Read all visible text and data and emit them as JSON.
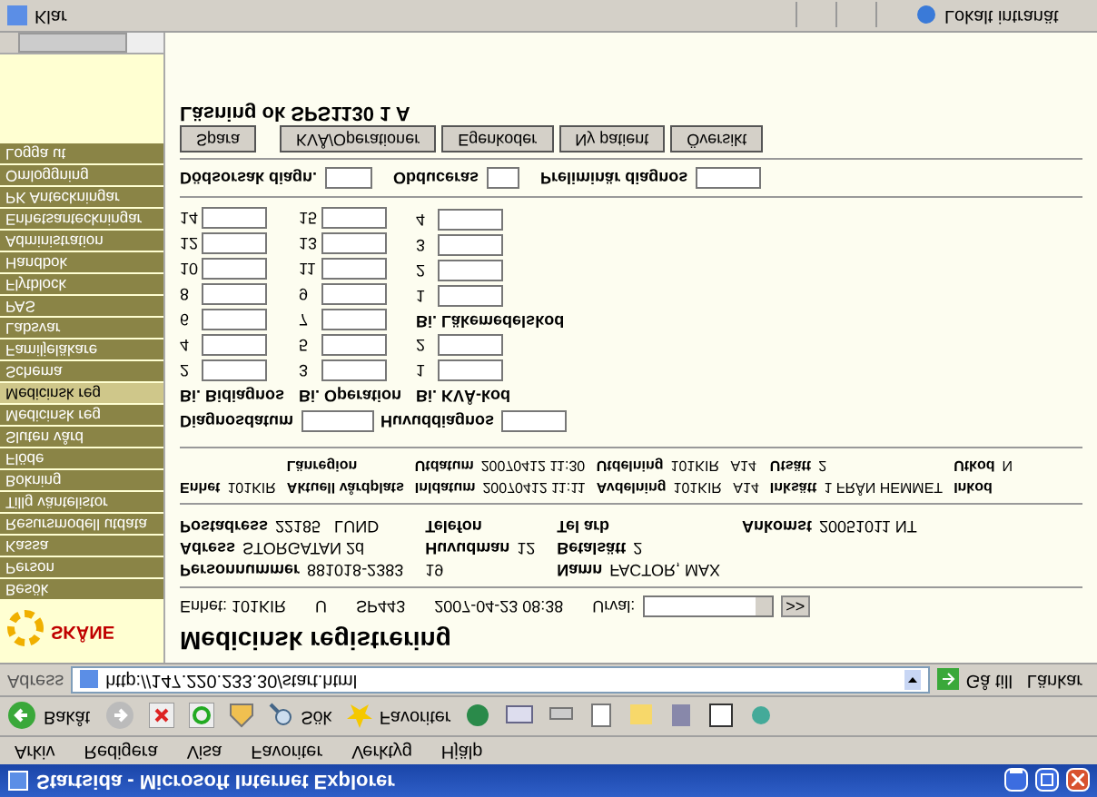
{
  "window": {
    "title": "Startsida - Microsoft Internet Explorer"
  },
  "menu_bar": [
    "Arkiv",
    "Redigera",
    "Visa",
    "Favoriter",
    "Verktyg",
    "Hjälp"
  ],
  "toolbar": {
    "back_label": "Bakåt",
    "search_label": "Sök",
    "favorites_label": "Favoriter"
  },
  "address_bar": {
    "label": "Adress",
    "url": "http://147.220.233.30/start.html",
    "go_label": "Gå till",
    "links_label": "Länkar"
  },
  "sidebar": {
    "logo_text": "SKÅNE",
    "items": [
      {
        "label": "Logga ut",
        "selected": false
      },
      {
        "label": "Omloggning",
        "selected": false
      },
      {
        "label": "PK Anteckningar",
        "selected": false
      },
      {
        "label": "Enhetsanteckningar",
        "selected": false
      },
      {
        "label": "Administration",
        "selected": false
      },
      {
        "label": "Handbok",
        "selected": false
      },
      {
        "label": "Flytblock",
        "selected": false
      },
      {
        "label": "PAS",
        "selected": false
      },
      {
        "label": "Labsvar",
        "selected": false
      },
      {
        "label": "Familjeläkare",
        "selected": false
      },
      {
        "label": "Schema",
        "selected": false
      },
      {
        "label": "Medicinsk reg",
        "selected": true
      },
      {
        "label": "Medicinsk reg",
        "selected": false
      },
      {
        "label": "Sluten vård",
        "selected": false
      },
      {
        "label": "Flöde",
        "selected": false
      },
      {
        "label": "Bokning",
        "selected": false
      },
      {
        "label": "Tillg väntelistor",
        "selected": false
      },
      {
        "label": "Resursmodell utdata",
        "selected": false
      },
      {
        "label": "Kassa",
        "selected": false
      },
      {
        "label": "Person",
        "selected": false
      },
      {
        "label": "Besök",
        "selected": false
      }
    ]
  },
  "page": {
    "title": "Medicinsk registrering",
    "context": {
      "unit": "Enhet: 101KIR",
      "fields": [
        "U",
        "SP443",
        "2007-04-23 08:38"
      ],
      "selection_label": "Urval:",
      "next_button": ">>"
    },
    "patient": [
      [
        {
          "label": "Postadress",
          "value": "22185   LUND"
        },
        {
          "label": "Telefon"
        },
        {
          "label": "Tel arb"
        },
        {
          "label": "Ankomst",
          "value": "20051011 NT"
        }
      ],
      [
        {
          "label": "Adress",
          "value": "STORGATAN 2d"
        },
        {
          "label": "Huvudman",
          "value": "12"
        },
        {
          "label": "Betalsätt",
          "value": "2"
        }
      ],
      [
        {
          "label": "Personnummer",
          "value": "881018-2383"
        },
        {
          "value": "19"
        },
        {
          "label": "Namn",
          "value": "FACTOR, MAX"
        }
      ]
    ],
    "stay": [
      [
        {
          "label": "Länregion"
        },
        {
          "label": "Utdatum",
          "value": "20070412 11:30"
        },
        {
          "label": "Utdelning",
          "value": "101KIR   A14"
        },
        {
          "label": "Utsätt",
          "value": "2"
        },
        {
          "label": "Utkod",
          "value": "N"
        }
      ],
      [
        {
          "label": "Enhet",
          "value": "101KIR"
        },
        {
          "label": "Aktuell vårdplats"
        },
        {
          "label": "Inldatum",
          "value": "20070412 11:11"
        },
        {
          "label": "Avdelning",
          "value": "101KIR   A14"
        },
        {
          "label": "Inksätt",
          "value": "1 FRÅN HEMMET"
        },
        {
          "label": "Inkod"
        }
      ]
    ],
    "diagnosis_date_label": "Diagnosdatum",
    "main_diagnosis_label": "Huvuddiagnos",
    "code_columns": [
      [
        {
          "heading": "Bi. Bidiagnos",
          "numbers": [
            "14",
            "12",
            "10",
            "8",
            "6",
            "4",
            "2"
          ]
        }
      ],
      [
        {
          "heading": "Bi. Operation",
          "numbers": [
            "15",
            "13",
            "11",
            "9",
            "7",
            "5",
            "3"
          ]
        }
      ],
      [
        {
          "heading": "Bi. Läkemedelskod",
          "numbers": [
            "4",
            "3",
            "2",
            "1"
          ]
        },
        {
          "heading": "Bi. KVÅ-kod",
          "numbers": [
            "2",
            "1"
          ]
        }
      ]
    ],
    "outcome_fields": [
      "Dödsorsak diagn.",
      "Obduceras",
      "Preliminär diagnos"
    ],
    "buttons": [
      "Spara",
      "KVÅ/Operationer",
      "Egenkoder",
      "Ny patient",
      "Översikt"
    ],
    "message": "Läsning ok SPS1130 1 A"
  },
  "status_bar": {
    "text": "Klar",
    "zone": "Lokalt intranät"
  }
}
